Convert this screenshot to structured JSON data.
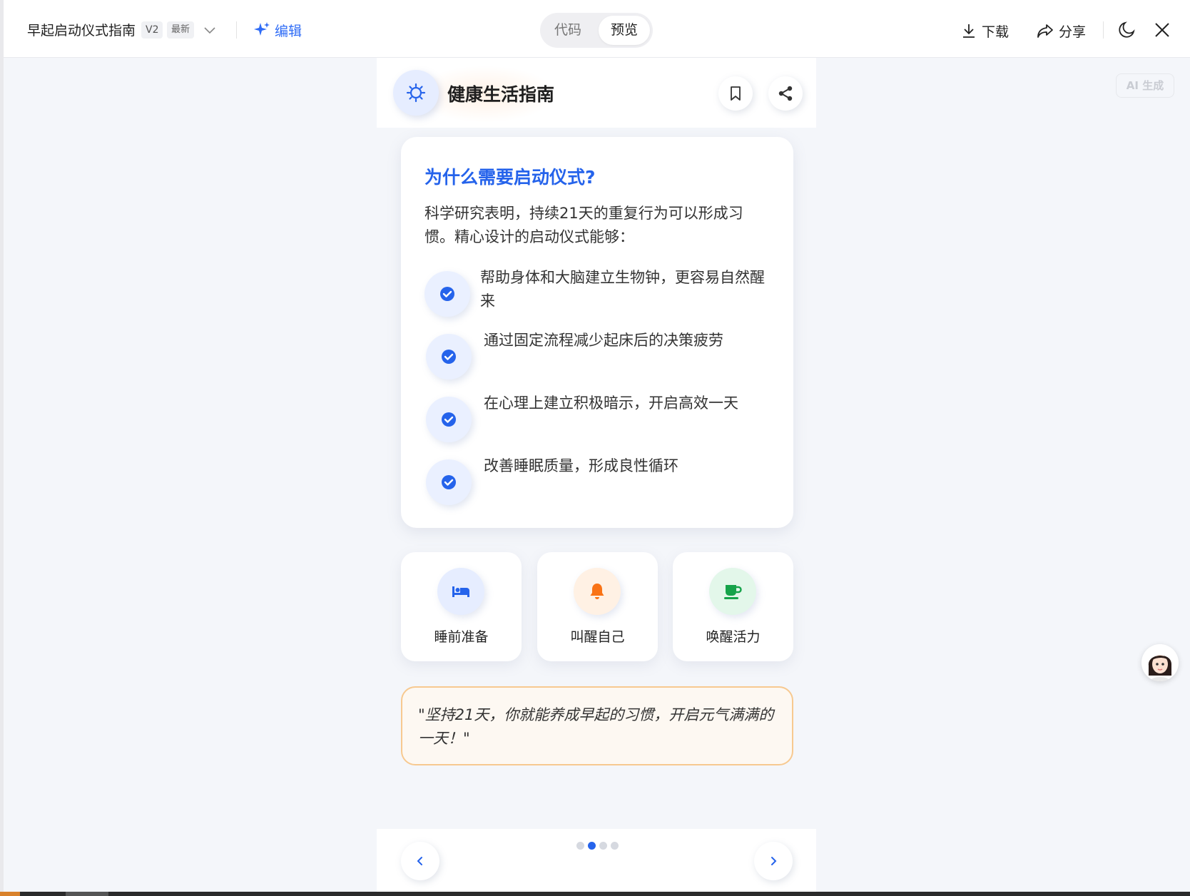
{
  "toolbar": {
    "doc_title": "早起启动仪式指南",
    "version": "V2",
    "latest": "最新",
    "edit_label": "编辑",
    "code_tab": "代码",
    "preview_tab": "预览",
    "download_label": "下载",
    "share_label": "分享"
  },
  "header": {
    "title": "健康生活指南"
  },
  "card": {
    "title": "为什么需要启动仪式?",
    "intro": "科学研究表明，持续21天的重复行为可以形成习惯。精心设计的启动仪式能够：",
    "points": [
      {
        "text": "帮助身体和大脑建立生物钟，更容易自然醒来"
      },
      {
        "text": "通过固定流程减少起床后的决策疲劳"
      },
      {
        "text": "在心理上建立积极暗示，开启高效一天"
      },
      {
        "text": "改善睡眠质量，形成良性循环"
      }
    ]
  },
  "actions": [
    {
      "label": "睡前准备",
      "icon": "bed-icon",
      "color": "#2563eb",
      "bg": "#e6edff"
    },
    {
      "label": "叫醒自己",
      "icon": "bell-icon",
      "color": "#f97316",
      "bg": "#fff1e4"
    },
    {
      "label": "唤醒活力",
      "icon": "coffee-icon",
      "color": "#16a34a",
      "bg": "#e3f7ea"
    }
  ],
  "quote": {
    "text": "\"坚持21天，你就能养成早起的习惯，开启元气满满的一天！\""
  },
  "pagination": {
    "current": 2,
    "total": 4
  },
  "ai_tag": "AI 生成",
  "colors": {
    "accent": "#2563eb",
    "edit": "#2f6cf6",
    "quote_border": "#f7c990"
  }
}
